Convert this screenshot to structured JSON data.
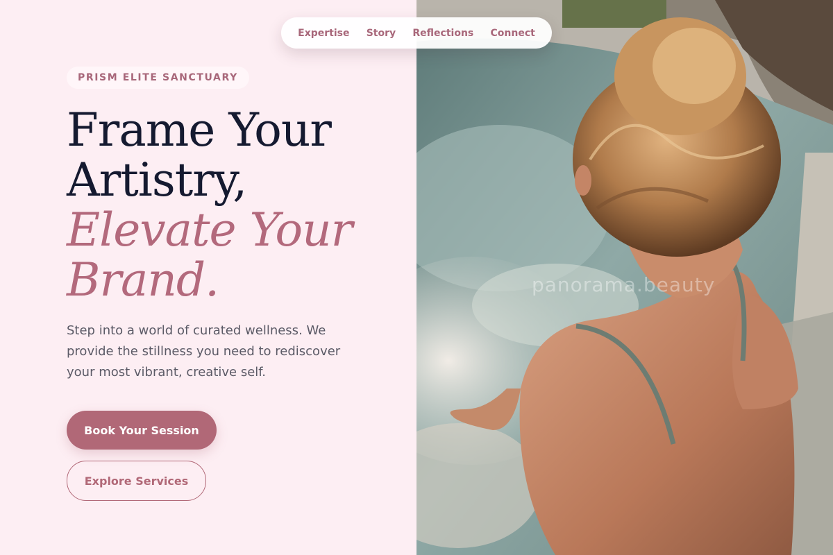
{
  "nav": {
    "items": [
      {
        "label": "Expertise"
      },
      {
        "label": "Story"
      },
      {
        "label": "Reflections"
      },
      {
        "label": "Connect"
      }
    ]
  },
  "hero": {
    "badge": "PRISM ELITE SANCTUARY",
    "headline": {
      "line1": "Frame Your",
      "line2": "Artistry,",
      "line3": "Elevate Your",
      "line4": "Brand."
    },
    "intro": "Step into a world of curated wellness. We provide the stillness you need to rediscover your most vibrant, creative self.",
    "primary_cta": "Book Your Session",
    "secondary_cta": "Explore Services"
  },
  "photo": {
    "watermark": "panorama.beauty"
  },
  "colors": {
    "background": "#fdeef3",
    "accent": "#b16877",
    "heading": "#151a30",
    "body_text": "#5b5a66"
  }
}
